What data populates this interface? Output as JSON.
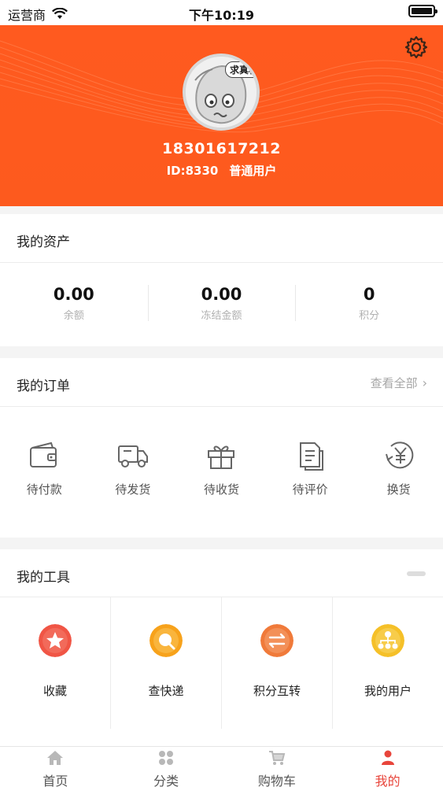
{
  "status_bar": {
    "carrier": "运营商",
    "time": "下午10:19"
  },
  "profile": {
    "avatar_text": "求真相",
    "phone": "18301617212",
    "id_text": "ID:8330",
    "user_type": "普通用户"
  },
  "assets": {
    "title": "我的资产",
    "items": [
      {
        "value": "0.00",
        "label": "余额"
      },
      {
        "value": "0.00",
        "label": "冻结金额"
      },
      {
        "value": "0",
        "label": "积分"
      }
    ]
  },
  "orders": {
    "title": "我的订单",
    "view_all": "查看全部",
    "items": [
      {
        "label": "待付款",
        "icon": "wallet-icon"
      },
      {
        "label": "待发货",
        "icon": "truck-icon"
      },
      {
        "label": "待收货",
        "icon": "gift-icon"
      },
      {
        "label": "待评价",
        "icon": "document-icon"
      },
      {
        "label": "换货",
        "icon": "exchange-yen-icon"
      }
    ]
  },
  "tools": {
    "title": "我的工具",
    "items": [
      {
        "label": "收藏",
        "icon": "star-icon",
        "color": "#f05545"
      },
      {
        "label": "查快递",
        "icon": "search-icon",
        "color": "#f7a21b"
      },
      {
        "label": "积分互转",
        "icon": "transfer-icon",
        "color": "#f07a3a"
      },
      {
        "label": "我的用户",
        "icon": "network-icon",
        "color": "#f5c028"
      }
    ]
  },
  "tabbar": {
    "items": [
      {
        "label": "首页",
        "icon": "home-icon"
      },
      {
        "label": "分类",
        "icon": "category-icon"
      },
      {
        "label": "购物车",
        "icon": "cart-icon"
      },
      {
        "label": "我的",
        "icon": "user-icon"
      }
    ],
    "active_color": "#e8453b"
  },
  "colors": {
    "header_bg": "#fd5a1e"
  }
}
